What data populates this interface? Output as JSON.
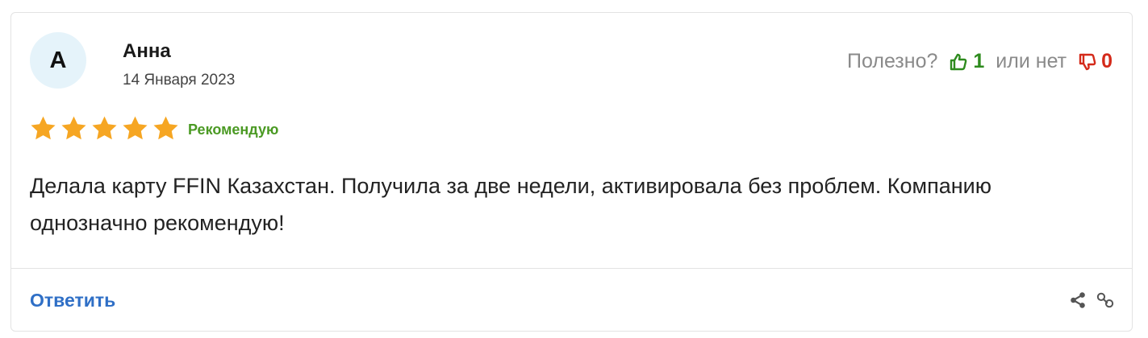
{
  "review": {
    "avatar_letter": "А",
    "author": "Анна",
    "date": "14 Января 2023",
    "helpful_label": "Полезно?",
    "likes": "1",
    "or_not": "или нет",
    "dislikes": "0",
    "rating": 5,
    "rating_max": 5,
    "recommend_label": "Рекомендую",
    "text": "Делала карту FFIN Казахстан. Получила за две недели, активировала без проблем. Компанию однозначно рекомендую!",
    "reply_label": "Ответить"
  },
  "colors": {
    "star": "#f6a623",
    "like": "#2e8b1e",
    "dislike": "#d42a1a",
    "recommend": "#4b9a24",
    "link": "#2f6fc6",
    "avatar_bg": "#e5f3fa"
  },
  "icons": {
    "like": "thumbs-up-icon",
    "dislike": "thumbs-down-icon",
    "share": "share-icon",
    "link": "link-icon",
    "star": "star-icon"
  }
}
